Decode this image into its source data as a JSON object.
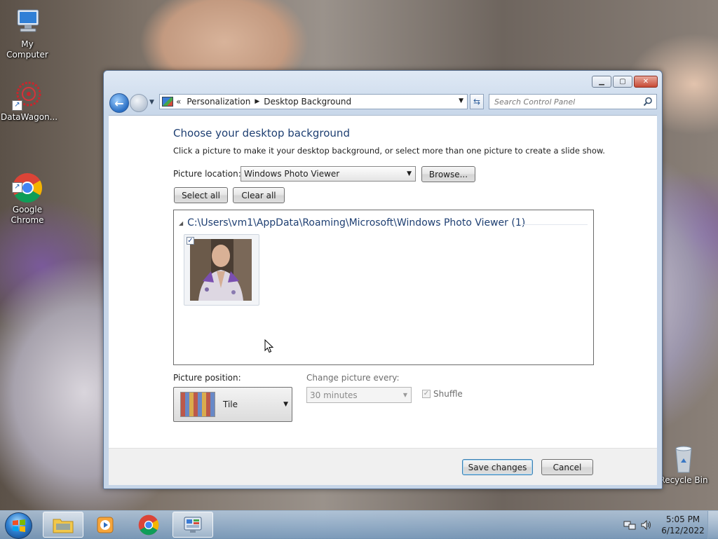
{
  "desktop": {
    "icons": [
      {
        "label": "My Computer"
      },
      {
        "label": "DataWagon..."
      },
      {
        "label": "Google\nChrome"
      },
      {
        "label": "Recycle Bin"
      }
    ]
  },
  "window": {
    "breadcrumb": [
      "Personalization",
      "Desktop Background"
    ],
    "search_placeholder": "Search Control Panel",
    "heading": "Choose your desktop background",
    "subtext": "Click a picture to make it your desktop background, or select more than one picture to create a slide show.",
    "picture_location_label": "Picture location:",
    "picture_location_value": "Windows Photo Viewer",
    "browse_label": "Browse...",
    "select_all_label": "Select all",
    "clear_all_label": "Clear all",
    "group_header": "C:\\Users\\vm1\\AppData\\Roaming\\Microsoft\\Windows Photo Viewer (1)",
    "thumbnail_checked": true,
    "picture_position_label": "Picture position:",
    "picture_position_value": "Tile",
    "change_every_label": "Change picture every:",
    "change_every_value": "30 minutes",
    "shuffle_label": "Shuffle",
    "shuffle_checked": true,
    "save_label": "Save changes",
    "cancel_label": "Cancel"
  },
  "taskbar": {
    "time": "5:05 PM",
    "date": "6/12/2022"
  },
  "colors": {
    "heading": "#1e3f72",
    "accent": "#3c7fb1"
  }
}
